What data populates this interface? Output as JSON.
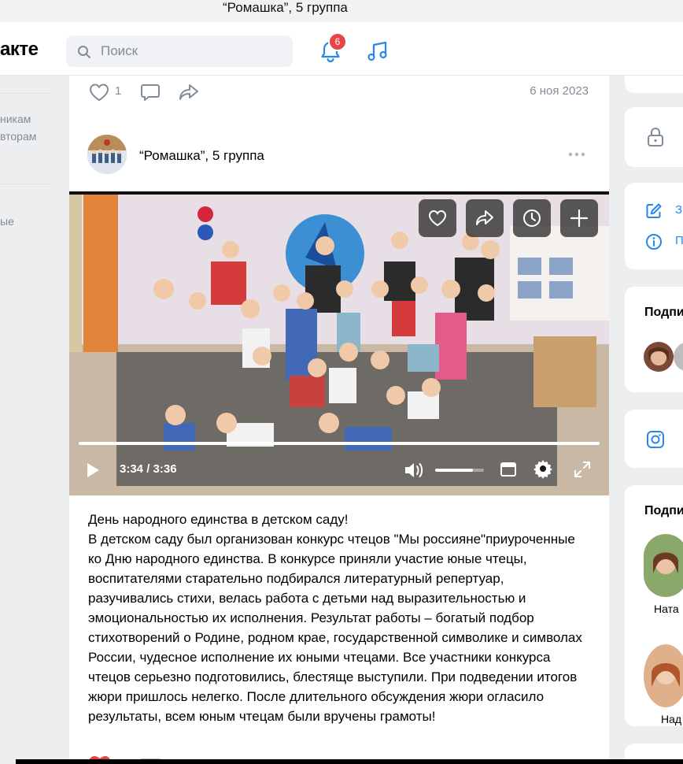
{
  "window": {
    "title": "“Ромашка”, 5 группа"
  },
  "header": {
    "logo": "акте",
    "search_placeholder": "Поиск",
    "notifications_count": "6"
  },
  "left_nav": {
    "items": [
      "никам",
      "вторам",
      "ые"
    ]
  },
  "prev_post": {
    "likes": "1",
    "date": "6 ноя 2023"
  },
  "post": {
    "author": "“Ромашка”, 5 группа",
    "video": {
      "time": "3:34 / 3:36",
      "progress": 0.99,
      "volume": 0.78
    },
    "text": "День народного единства в детском саду!\nВ детском саду был организован конкурс чтецов \"Мы россияне\"приуроченные ко Дню народного единства. В конкурсе приняли участие  юные чтецы, воспитателями старательно подбирался литературный репертуар, разучивались стихи, велась работа с детьми над выразительностью и эмоциональностью их исполнения. Результат работы – богатый подбор стихотворений о Родине, родном крае, государственной символике и символах России, чудесное исполнение их юными чтецами. Все участники конкурса чтецов серьезно подготовились, блестяще выступили. При подведении итогов жюри пришлось нелегко. После длительного обсуждения жюри огласило результаты, всем юным чтецам были вручены грамоты!"
  },
  "right_col": {
    "links": [
      "З",
      "П"
    ],
    "subs_title_1": "Подпи",
    "subs_title_2": "Подпи",
    "person_1": "Ната",
    "person_2": "Над"
  },
  "colors": {
    "accent": "#2688eb",
    "badge": "#e64646",
    "muted": "#818c99"
  }
}
